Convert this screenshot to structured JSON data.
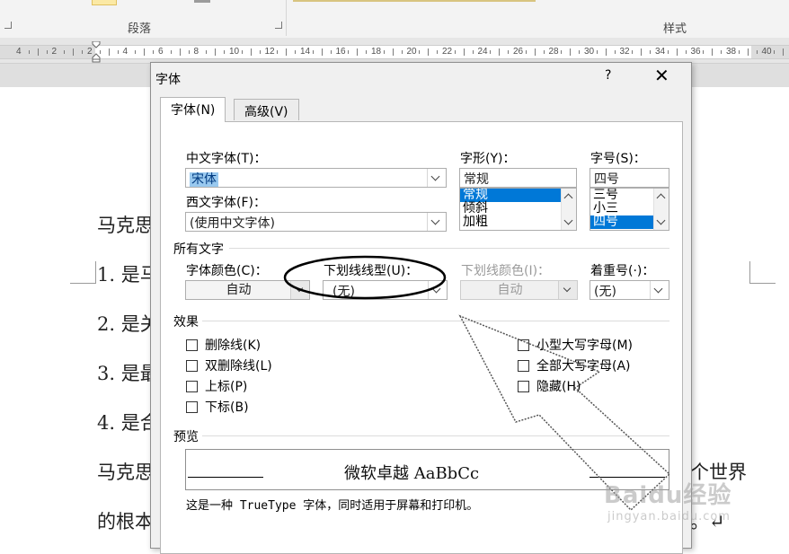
{
  "ribbon": {
    "paragraph_group": "段落",
    "styles_group": "样式"
  },
  "ruler": {
    "numbers": [
      "4",
      "2",
      "2",
      "4",
      "6",
      "8",
      "10",
      "12",
      "14",
      "16",
      "18",
      "20",
      "22",
      "24",
      "26",
      "28",
      "30",
      "32",
      "34",
      "36",
      "38",
      "40"
    ]
  },
  "document": {
    "lines": [
      "马克思",
      "1. 是马",
      "2. 是关",
      "3. 是最",
      "4. 是合",
      "马克思",
      "的根本"
    ],
    "tails": [
      "个世界",
      "。↵"
    ]
  },
  "dialog": {
    "title": "字体",
    "help": "?",
    "close": "✕",
    "tabs": [
      {
        "label": "字体(N)"
      },
      {
        "label": "高级(V)"
      }
    ],
    "chinese_font": {
      "label": "中文字体(T)：",
      "value": "宋体"
    },
    "western_font": {
      "label": "西文字体(F)：",
      "value": "(使用中文字体)"
    },
    "style": {
      "label": "字形(Y)：",
      "value": "常规",
      "options": [
        "常规",
        "倾斜",
        "加粗"
      ],
      "selected": 0
    },
    "size": {
      "label": "字号(S)：",
      "value": "四号",
      "options": [
        "三号",
        "小三",
        "四号"
      ],
      "selected": 2
    },
    "all_text": {
      "title": "所有文字",
      "font_color": {
        "label": "字体颜色(C)：",
        "value": "自动"
      },
      "underline_style": {
        "label": "下划线线型(U)：",
        "value": "(无)"
      },
      "underline_color": {
        "label": "下划线颜色(I)：",
        "value": "自动"
      },
      "emphasis": {
        "label": "着重号(·)：",
        "value": "(无)"
      }
    },
    "effects": {
      "title": "效果",
      "left": [
        {
          "label": "删除线(K)",
          "checked": false
        },
        {
          "label": "双删除线(L)",
          "checked": false
        },
        {
          "label": "上标(P)",
          "checked": false
        },
        {
          "label": "下标(B)",
          "checked": false
        }
      ],
      "right": [
        {
          "label": "小型大写字母(M)",
          "checked": false
        },
        {
          "label": "全部大写字母(A)",
          "checked": false
        },
        {
          "label": "隐藏(H)",
          "checked": false
        }
      ]
    },
    "preview": {
      "title": "预览",
      "sample": "微软卓越  AaBbCc",
      "note": "这是一种 TrueType 字体，同时适用于屏幕和打印机。"
    }
  },
  "watermark": {
    "brand": "Baidu经验",
    "url": "jingyan.baidu.com"
  }
}
